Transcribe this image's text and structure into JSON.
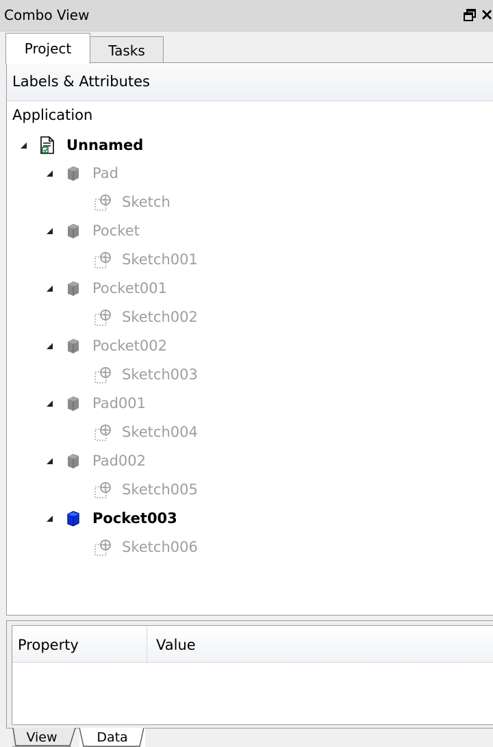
{
  "window": {
    "title": "Combo View",
    "close_label": "×"
  },
  "top_tabs": [
    {
      "label": "Project",
      "active": true
    },
    {
      "label": "Tasks",
      "active": false
    }
  ],
  "tree": {
    "header": "Labels & Attributes",
    "root": "Application",
    "items": [
      {
        "label": "Unnamed",
        "icon": "document-icon",
        "style": "bold"
      },
      {
        "label": "Pad",
        "icon": "cube-gray-icon",
        "style": "dim"
      },
      {
        "label": "Sketch",
        "icon": "sketch-icon",
        "style": "dim"
      },
      {
        "label": "Pocket",
        "icon": "cube-gray-icon",
        "style": "dim"
      },
      {
        "label": "Sketch001",
        "icon": "sketch-icon",
        "style": "dim"
      },
      {
        "label": "Pocket001",
        "icon": "cube-gray-icon",
        "style": "dim"
      },
      {
        "label": "Sketch002",
        "icon": "sketch-icon",
        "style": "dim"
      },
      {
        "label": "Pocket002",
        "icon": "cube-gray-icon",
        "style": "dim"
      },
      {
        "label": "Sketch003",
        "icon": "sketch-icon",
        "style": "dim"
      },
      {
        "label": "Pad001",
        "icon": "cube-gray-icon",
        "style": "dim"
      },
      {
        "label": "Sketch004",
        "icon": "sketch-icon",
        "style": "dim"
      },
      {
        "label": "Pad002",
        "icon": "cube-gray-icon",
        "style": "dim"
      },
      {
        "label": "Sketch005",
        "icon": "sketch-icon",
        "style": "dim"
      },
      {
        "label": "Pocket003",
        "icon": "cube-blue-icon",
        "style": "bold"
      },
      {
        "label": "Sketch006",
        "icon": "sketch-icon",
        "style": "dim"
      }
    ]
  },
  "properties": {
    "col_property": "Property",
    "col_value": "Value"
  },
  "bottom_tabs": [
    {
      "label": "View",
      "active": false
    },
    {
      "label": "Data",
      "active": true
    }
  ],
  "colors": {
    "dim_text": "#9e9e9e",
    "active_cube": "#0a2fd8",
    "inactive_cube": "#8a8a8a"
  }
}
